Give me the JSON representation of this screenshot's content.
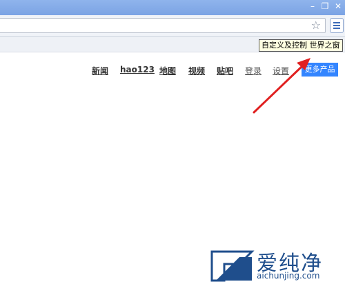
{
  "toolbar": {
    "tooltip": "自定义及控制 世界之窗"
  },
  "nav": {
    "items": [
      "新闻",
      "hao123",
      "地图",
      "视频",
      "贴吧"
    ],
    "login": "登录",
    "settings": "设置",
    "more": "更多产品"
  },
  "watermark": {
    "brand": "爱纯净",
    "url": "aichunjing.com"
  },
  "icons": [
    "minimize-icon",
    "restore-icon",
    "close-icon",
    "star-icon",
    "menu-icon"
  ],
  "colors": {
    "accent": "#3385ff",
    "arrow": "#e02020",
    "titlebar": "#7ba3e4"
  }
}
